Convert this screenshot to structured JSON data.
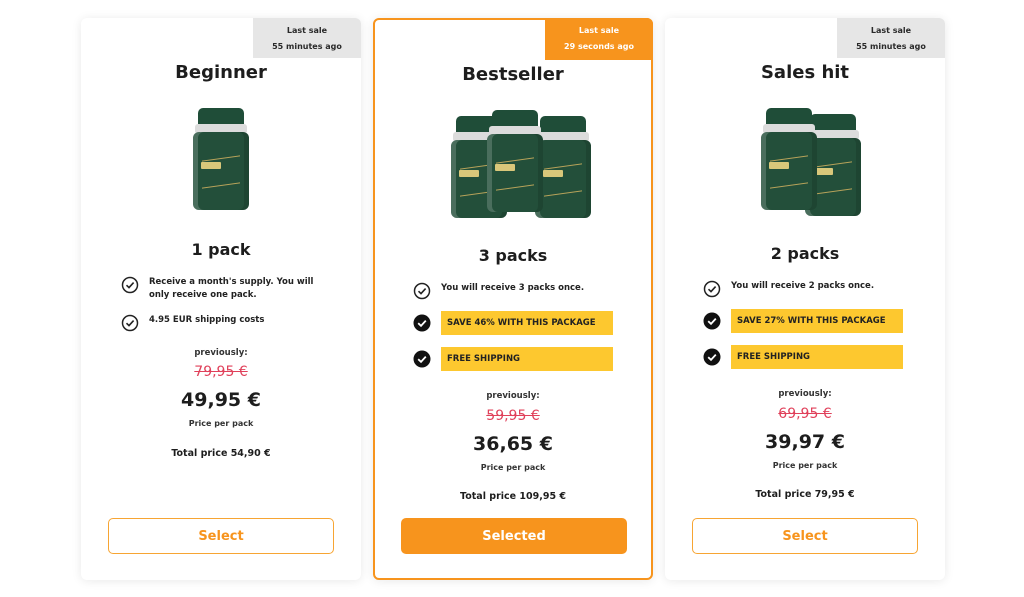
{
  "plans": [
    {
      "last_sale_label": "Last sale",
      "last_sale_time": "55 minutes ago",
      "title": "Beginner",
      "pack_label": "1 pack",
      "features": [
        "Receive a month's supply. You will only receive one pack.",
        "4.95 EUR shipping costs"
      ],
      "highlights": [],
      "previously_label": "previously:",
      "old_price": "79,95 €",
      "price": "49,95 €",
      "price_unit": "Price per pack",
      "total": "Total price 54,90 €",
      "button_label": "Select"
    },
    {
      "last_sale_label": "Last sale",
      "last_sale_time": "29 seconds ago",
      "title": "Bestseller",
      "pack_label": "3 packs",
      "features": [
        "You will receive 3 packs once."
      ],
      "highlights": [
        "SAVE 46% WITH THIS PACKAGE",
        "FREE SHIPPING"
      ],
      "previously_label": "previously:",
      "old_price": "59,95 €",
      "price": "36,65 €",
      "price_unit": "Price per pack",
      "total": "Total price 109,95 €",
      "button_label": "Selected"
    },
    {
      "last_sale_label": "Last sale",
      "last_sale_time": "55 minutes ago",
      "title": "Sales hit",
      "pack_label": "2 packs",
      "features": [
        "You will receive 2 packs once."
      ],
      "highlights": [
        "SAVE 27% WITH THIS PACKAGE",
        "FREE SHIPPING"
      ],
      "previously_label": "previously:",
      "old_price": "69,95 €",
      "price": "39,97 €",
      "price_unit": "Price per pack",
      "total": "Total price 79,95 €",
      "button_label": "Select"
    }
  ],
  "colors": {
    "accent": "#f7941d",
    "highlight": "#fdc82f",
    "strikethrough": "#e0405a",
    "bottle": "#234f3a"
  },
  "icons": {
    "check_outline": "check-circle-outline-icon",
    "check_filled": "check-circle-filled-icon"
  }
}
